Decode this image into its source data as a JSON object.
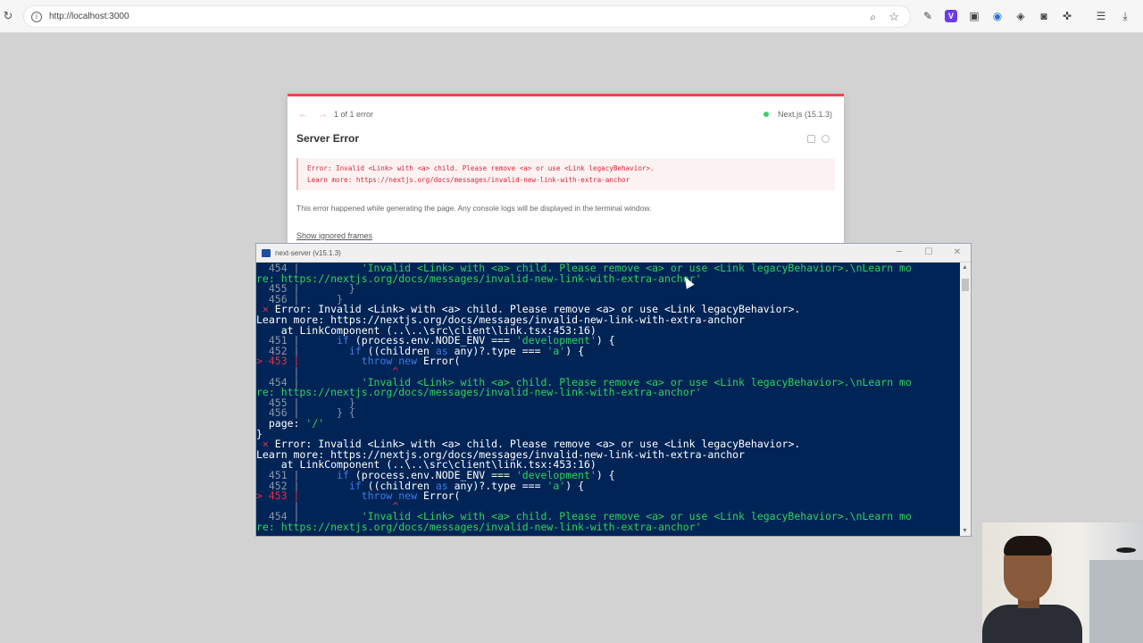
{
  "browser": {
    "url": "http://localhost:3000",
    "reload_icon": "reload-icon",
    "extension_icons": [
      "zoom-icon",
      "star-icon",
      "pen-icon",
      "v-extension-icon",
      "cast-icon",
      "capture-icon",
      "eye-icon",
      "camera-icon",
      "puzzle-icon",
      "menu-list-icon",
      "download-icon"
    ],
    "v_label": "V"
  },
  "overlay": {
    "nav": "← →",
    "error_count": "1 of 1 error",
    "version": "Next.js (15.1.3)",
    "title": "Server Error",
    "error_line1": "Error: Invalid <Link> with <a> child. Please remove <a> or use <Link legacyBehavior>.",
    "error_line2": "Learn more: https://nextjs.org/docs/messages/invalid-new-link-with-extra-anchor",
    "hint": "This error happened while generating the page. Any console logs will be displayed in the terminal window.",
    "show_frames": "Show ignored frames",
    "accent_color": "#e5484d"
  },
  "terminal": {
    "title": "next-server (v15.1.3)",
    "buttons": {
      "minimize": "─",
      "maximize": "☐",
      "close": "✕"
    },
    "lines": [
      [
        [
          "gy",
          "  454 |          "
        ],
        [
          "g",
          "'Invalid <Link> with <a> child. Please remove <a> or use <Link legacyBehavior>.\\nLearn mo"
        ]
      ],
      [
        [
          "g",
          "re: https://nextjs.org/docs/messages/invalid-new-link-with-extra-anchor'"
        ]
      ],
      [
        [
          "gy",
          "  455 |        }"
        ]
      ],
      [
        [
          "gy",
          "  456 |      }"
        ]
      ],
      [
        [
          "r",
          " ⨯ "
        ],
        [
          "w",
          "Error: Invalid <Link> with <a> child. Please remove <a> or use <Link legacyBehavior>."
        ]
      ],
      [
        [
          "w",
          "Learn more: https://nextjs.org/docs/messages/invalid-new-link-with-extra-anchor"
        ]
      ],
      [
        [
          "w",
          "    at LinkComponent (..\\..\\src\\client\\link.tsx:453:16)"
        ]
      ],
      [
        [
          "gy",
          "  451 |      "
        ],
        [
          "k",
          "if"
        ],
        [
          "w",
          " (process.env.NODE_ENV === "
        ],
        [
          "g",
          "'development'"
        ],
        [
          "w",
          ") {"
        ]
      ],
      [
        [
          "gy",
          "  452 |        "
        ],
        [
          "k",
          "if"
        ],
        [
          "w",
          " ((children "
        ],
        [
          "k",
          "as"
        ],
        [
          "w",
          " any)?.type === "
        ],
        [
          "g",
          "'a'"
        ],
        [
          "w",
          ") {"
        ]
      ],
      [
        [
          "r",
          "> 453 |          "
        ],
        [
          "k",
          "throw new"
        ],
        [
          "w",
          " Error("
        ]
      ],
      [
        [
          "gy",
          "      |          "
        ],
        [
          "r",
          "     ^"
        ]
      ],
      [
        [
          "gy",
          "  454 |          "
        ],
        [
          "g",
          "'Invalid <Link> with <a> child. Please remove <a> or use <Link legacyBehavior>.\\nLearn mo"
        ]
      ],
      [
        [
          "g",
          "re: https://nextjs.org/docs/messages/invalid-new-link-with-extra-anchor'"
        ]
      ],
      [
        [
          "gy",
          "  455 |        }"
        ]
      ],
      [
        [
          "gy",
          "  456 |      } {"
        ]
      ],
      [
        [
          "w",
          "  page: "
        ],
        [
          "g",
          "'/'"
        ]
      ],
      [
        [
          "w",
          "}"
        ]
      ],
      [
        [
          "r",
          " ⨯ "
        ],
        [
          "w",
          "Error: Invalid <Link> with <a> child. Please remove <a> or use <Link legacyBehavior>."
        ]
      ],
      [
        [
          "w",
          "Learn more: https://nextjs.org/docs/messages/invalid-new-link-with-extra-anchor"
        ]
      ],
      [
        [
          "w",
          "    at LinkComponent (..\\..\\src\\client\\link.tsx:453:16)"
        ]
      ],
      [
        [
          "gy",
          "  451 |      "
        ],
        [
          "k",
          "if"
        ],
        [
          "w",
          " (process.env.NODE_ENV === "
        ],
        [
          "g",
          "'development'"
        ],
        [
          "w",
          ") {"
        ]
      ],
      [
        [
          "gy",
          "  452 |        "
        ],
        [
          "k",
          "if"
        ],
        [
          "w",
          " ((children "
        ],
        [
          "k",
          "as"
        ],
        [
          "w",
          " any)?.type === "
        ],
        [
          "g",
          "'a'"
        ],
        [
          "w",
          ") {"
        ]
      ],
      [
        [
          "r",
          "> 453 |          "
        ],
        [
          "k",
          "throw new"
        ],
        [
          "w",
          " Error("
        ]
      ],
      [
        [
          "gy",
          "      |          "
        ],
        [
          "r",
          "     ^"
        ]
      ],
      [
        [
          "gy",
          "  454 |          "
        ],
        [
          "g",
          "'Invalid <Link> with <a> child. Please remove <a> or use <Link legacyBehavior>.\\nLearn mo"
        ]
      ],
      [
        [
          "g",
          "re: https://nextjs.org/docs/messages/invalid-new-link-with-extra-anchor'"
        ]
      ]
    ],
    "background_color": "#012456"
  },
  "webcam": {
    "subject": "presenter-webcam"
  }
}
